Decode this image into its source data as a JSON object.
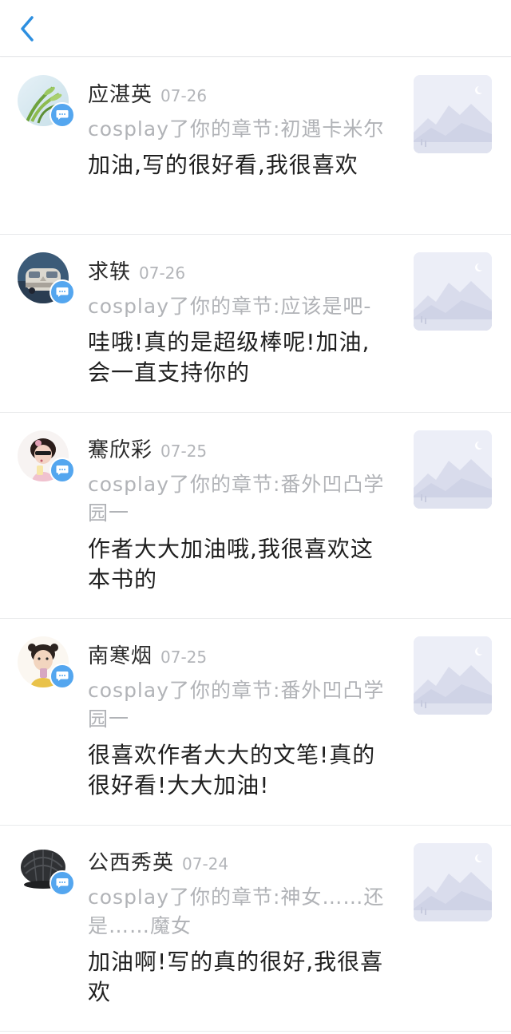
{
  "topbar": {
    "back_icon": "chevron-left-icon",
    "accent": "#2d8fe0"
  },
  "badge_color": "#54a6ef",
  "comments": [
    {
      "name": "应湛英",
      "date": "07-26",
      "source": "cosplay了你的章节:初遇卡米尔",
      "comment": "加油,写的很好看,我很喜欢"
    },
    {
      "name": "求轶",
      "date": "07-26",
      "source": "cosplay了你的章节:应该是吧-",
      "comment": "哇哦!真的是超级棒呢!加油,会一直支持你的"
    },
    {
      "name": "騫欣彩",
      "date": "07-25",
      "source": "cosplay了你的章节:番外凹凸学园一",
      "comment": "作者大大加油哦,我很喜欢这本书的"
    },
    {
      "name": "南寒烟",
      "date": "07-25",
      "source": "cosplay了你的章节:番外凹凸学园一",
      "comment": "很喜欢作者大大的文笔!真的很好看!大大加油!"
    },
    {
      "name": "公西秀英",
      "date": "07-24",
      "source": "cosplay了你的章节:神女……还是……魔女",
      "comment": "加油啊!写的真的很好,我很喜欢"
    }
  ]
}
